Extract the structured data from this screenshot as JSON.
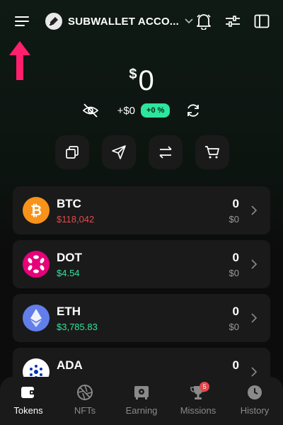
{
  "header": {
    "account_name": "SUBWALLET ACCO...",
    "icons": [
      "menu-icon",
      "wallet-avatar-icon",
      "chevron-down-icon",
      "bell-icon",
      "sliders-icon",
      "sidebar-icon"
    ]
  },
  "balance": {
    "currency": "$",
    "value": "0",
    "change": "+$0",
    "change_percent": "+0 %"
  },
  "actions": [
    {
      "name": "copy-address",
      "icon": "copy-icon"
    },
    {
      "name": "send",
      "icon": "send-icon"
    },
    {
      "name": "swap",
      "icon": "swap-icon"
    },
    {
      "name": "buy",
      "icon": "cart-icon"
    }
  ],
  "tokens": [
    {
      "symbol": "BTC",
      "price": "$118,042",
      "price_color": "#e5484d",
      "amount": "0",
      "value": "$0",
      "logo_color": "#f7931a"
    },
    {
      "symbol": "DOT",
      "price": "$4.54",
      "price_color": "#2ee59d",
      "amount": "0",
      "value": "$0",
      "logo_color": "#e6007a"
    },
    {
      "symbol": "ETH",
      "price": "$3,785.83",
      "price_color": "#2ee59d",
      "amount": "0",
      "value": "$0",
      "logo_color": "#627eea"
    },
    {
      "symbol": "ADA",
      "price": "",
      "price_color": "#2ee59d",
      "amount": "0",
      "value": "",
      "logo_color": "#ffffff"
    }
  ],
  "nav": [
    {
      "label": "Tokens",
      "icon": "wallet-icon",
      "active": true
    },
    {
      "label": "NFTs",
      "icon": "aperture-icon",
      "active": false
    },
    {
      "label": "Earning",
      "icon": "safe-icon",
      "active": false
    },
    {
      "label": "Missions",
      "icon": "trophy-icon",
      "active": false,
      "badge": "5"
    },
    {
      "label": "History",
      "icon": "clock-icon",
      "active": false
    }
  ],
  "colors": {
    "accent_green": "#2ee59d",
    "negative_red": "#e5484d",
    "arrow_pink": "#ff1f6d"
  }
}
